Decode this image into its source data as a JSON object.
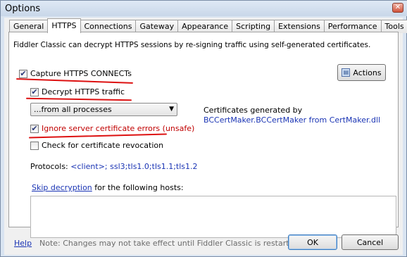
{
  "window": {
    "title": "Options",
    "close_glyph": "✕"
  },
  "tabs": [
    {
      "label": "General",
      "active": false
    },
    {
      "label": "HTTPS",
      "active": true
    },
    {
      "label": "Connections",
      "active": false
    },
    {
      "label": "Gateway",
      "active": false
    },
    {
      "label": "Appearance",
      "active": false
    },
    {
      "label": "Scripting",
      "active": false
    },
    {
      "label": "Extensions",
      "active": false
    },
    {
      "label": "Performance",
      "active": false
    },
    {
      "label": "Tools",
      "active": false
    }
  ],
  "https": {
    "intro": "Fiddler Classic can decrypt HTTPS sessions by re-signing traffic using self-generated certificates.",
    "capture_connects": {
      "label": "Capture HTTPS CONNECTs",
      "checked": true
    },
    "decrypt_traffic": {
      "label": "Decrypt HTTPS traffic",
      "checked": true
    },
    "process_filter": {
      "selected": "...from all processes"
    },
    "ignore_cert_errors": {
      "label": "Ignore server certificate errors (unsafe)",
      "checked": true
    },
    "check_revocation": {
      "label": "Check for certificate revocation",
      "checked": false
    },
    "actions_label": "Actions",
    "certs_label": "Certificates generated by",
    "certs_value": "BCCertMaker.BCCertMaker from CertMaker.dll",
    "protocols_label": "Protocols:",
    "protocols_value": "<client>; ssl3;tls1.0;tls1.1;tls1.2",
    "skip_link": "Skip decryption",
    "skip_suffix": " for the following hosts:",
    "hosts_value": ""
  },
  "footer": {
    "help": "Help",
    "note": "Note: Changes may not take effect until Fiddler Classic is restarted.",
    "ok": "OK",
    "cancel": "Cancel"
  },
  "colors": {
    "link": "#1a34b4",
    "annotation": "#dd1111",
    "warning_text": "#c00000"
  },
  "check_glyph": "✔"
}
